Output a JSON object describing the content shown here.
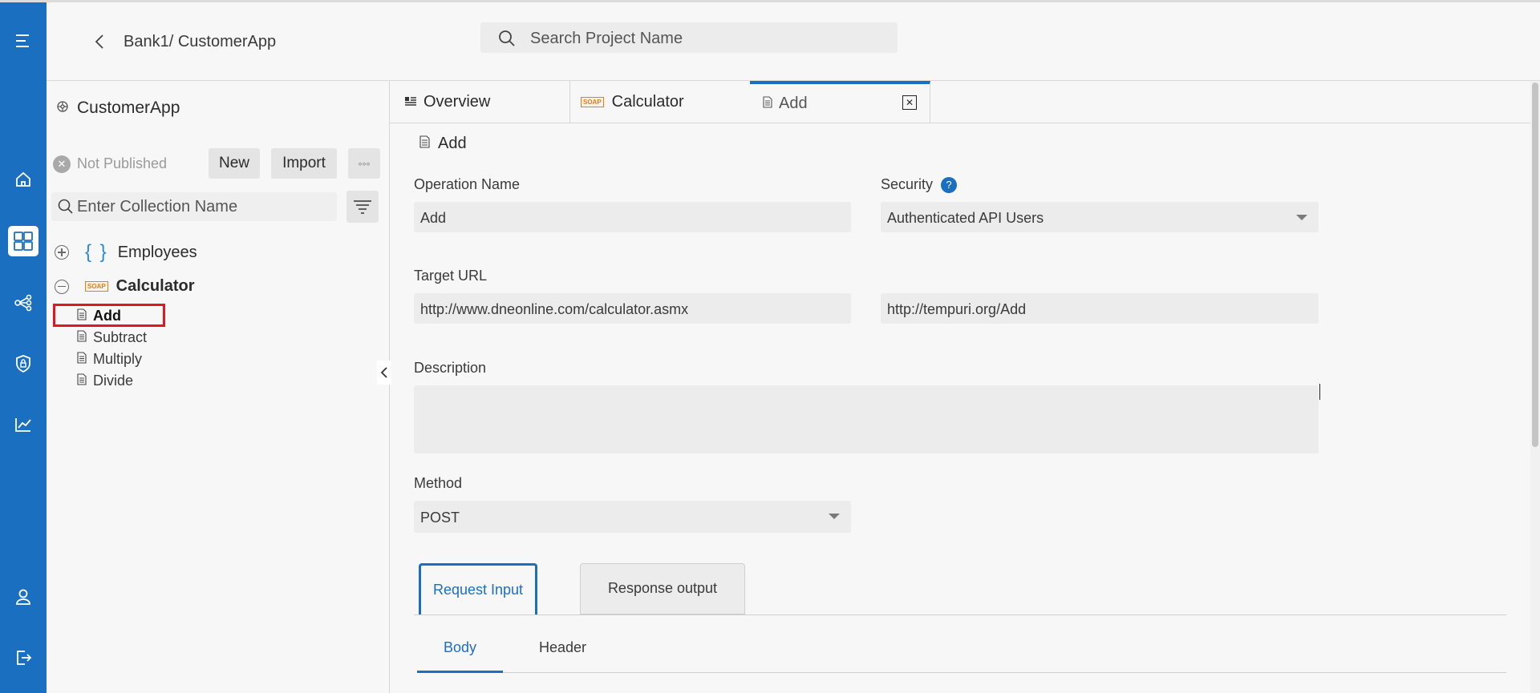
{
  "header": {
    "breadcrumb": "Bank1/ CustomerApp",
    "search_placeholder": "Search Project Name"
  },
  "sidebar": {
    "app_name": "CustomerApp",
    "status": "Not Published",
    "new_label": "New",
    "import_label": "Import",
    "more_label": "◦◦◦",
    "collection_placeholder": "Enter Collection Name",
    "collections": [
      {
        "name": "Employees",
        "type_icon": "json-braces-icon",
        "expanded": false
      },
      {
        "name": "Calculator",
        "type_icon": "soap-icon",
        "expanded": true
      }
    ],
    "soap_badge": "SOAP",
    "operations": [
      "Add",
      "Subtract",
      "Multiply",
      "Divide"
    ],
    "selected_operation": "Add"
  },
  "tabs": [
    {
      "label": "Overview",
      "icon": "overview-icon"
    },
    {
      "label": "Calculator",
      "icon": "soap-icon"
    },
    {
      "label": "Add",
      "icon": "document-icon",
      "active": true
    }
  ],
  "operation": {
    "title": "Add",
    "name_label": "Operation Name",
    "name_value": "Add",
    "security_label": "Security",
    "security_value": "Authenticated API Users",
    "target_url_label": "Target URL",
    "target_url_value": "http://www.dneonline.com/calculator.asmx",
    "soap_action_value": "http://tempuri.org/Add",
    "description_label": "Description",
    "description_value": "",
    "method_label": "Method",
    "method_value": "POST"
  },
  "request_tabs": [
    "Request Input",
    "Response output"
  ],
  "sub_tabs": [
    "Body",
    "Header"
  ],
  "colors": {
    "brand": "#1b6fc1",
    "highlight": "#e3161f",
    "soap": "#e67e17"
  }
}
